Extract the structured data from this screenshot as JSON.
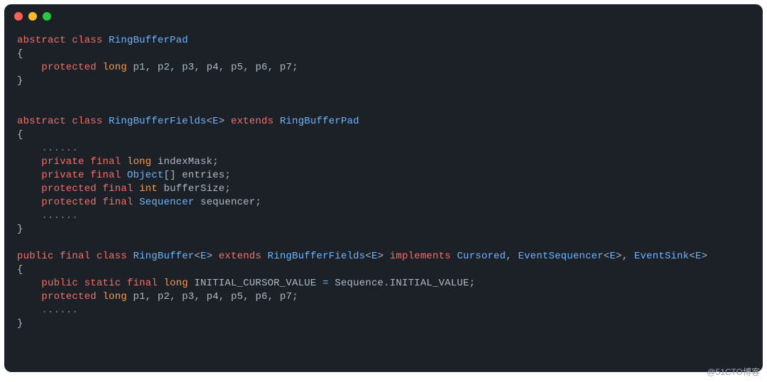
{
  "window": {
    "dots": [
      "close",
      "minimize",
      "zoom"
    ]
  },
  "tok": {
    "abstract": "abstract",
    "class": "class",
    "protected": "protected",
    "private": "private",
    "final": "final",
    "extends": "extends",
    "implements": "implements",
    "public": "public",
    "static": "static",
    "long": "long",
    "int": "int",
    "lbrace": "{",
    "rbrace": "}",
    "lb": "[",
    "rb": "]",
    "lt": "<",
    "gt": ">",
    "semi": ";",
    "comma": ",",
    "eq": "=",
    "doteq": ".",
    "dots": "......"
  },
  "names": {
    "RingBufferPad": "RingBufferPad",
    "RingBufferFields": "RingBufferFields",
    "RingBuffer": "RingBuffer",
    "E": "E",
    "Object": "Object",
    "Sequencer": "Sequencer",
    "sequencer": "sequencer",
    "indexMask": "indexMask",
    "entries": "entries",
    "bufferSize": "bufferSize",
    "Cursored": "Cursored",
    "EventSequencer": "EventSequencer",
    "EventSink": "EventSink",
    "INITIAL_CURSOR_VALUE": "INITIAL_CURSOR_VALUE",
    "Sequence": "Sequence",
    "INITIAL_VALUE": "INITIAL_VALUE",
    "p1": "p1",
    "p2": "p2",
    "p3": "p3",
    "p4": "p4",
    "p5": "p5",
    "p6": "p6",
    "p7": "p7"
  },
  "watermark": "@51CTO博客"
}
